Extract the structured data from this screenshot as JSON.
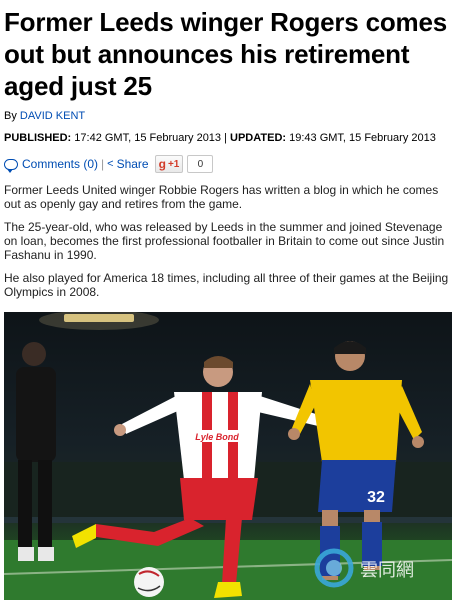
{
  "article": {
    "headline": "Former Leeds winger Rogers comes out but announces his retirement aged just 25",
    "byline_prefix": "By",
    "author": "DAVID KENT",
    "published_label": "PUBLISHED:",
    "published_value": "17:42 GMT, 15 February 2013",
    "date_separator": "|",
    "updated_label": "UPDATED:",
    "updated_value": "19:43 GMT, 15 February 2013"
  },
  "share_bar": {
    "comments_label": "Comments (0)",
    "share_label": "Share",
    "gplus_label": "+1",
    "gplus_count": "0"
  },
  "paragraphs": [
    "Former Leeds United winger Robbie Rogers has written a blog in which he comes out as openly gay and retires from the game.",
    "The 25-year-old, who was released by Leeds in the summer and joined Stevenage on loan, becomes the first professional footballer in Britain to come out since Justin Fashanu in 1990.",
    "He also played for America 18 times, including all three of their games at the Beijing Olympics in 2008."
  ],
  "photo": {
    "sponsor_text": "Lyle Bond",
    "away_number": "32",
    "watermark_text": "雲同網"
  },
  "colors": {
    "link": "#004db3",
    "home_kit": "#ffffff",
    "home_kit_accent": "#d9232d",
    "away_kit": "#f2c500",
    "away_shorts": "#1c3e9c",
    "pitch": "#2a6b2b"
  }
}
